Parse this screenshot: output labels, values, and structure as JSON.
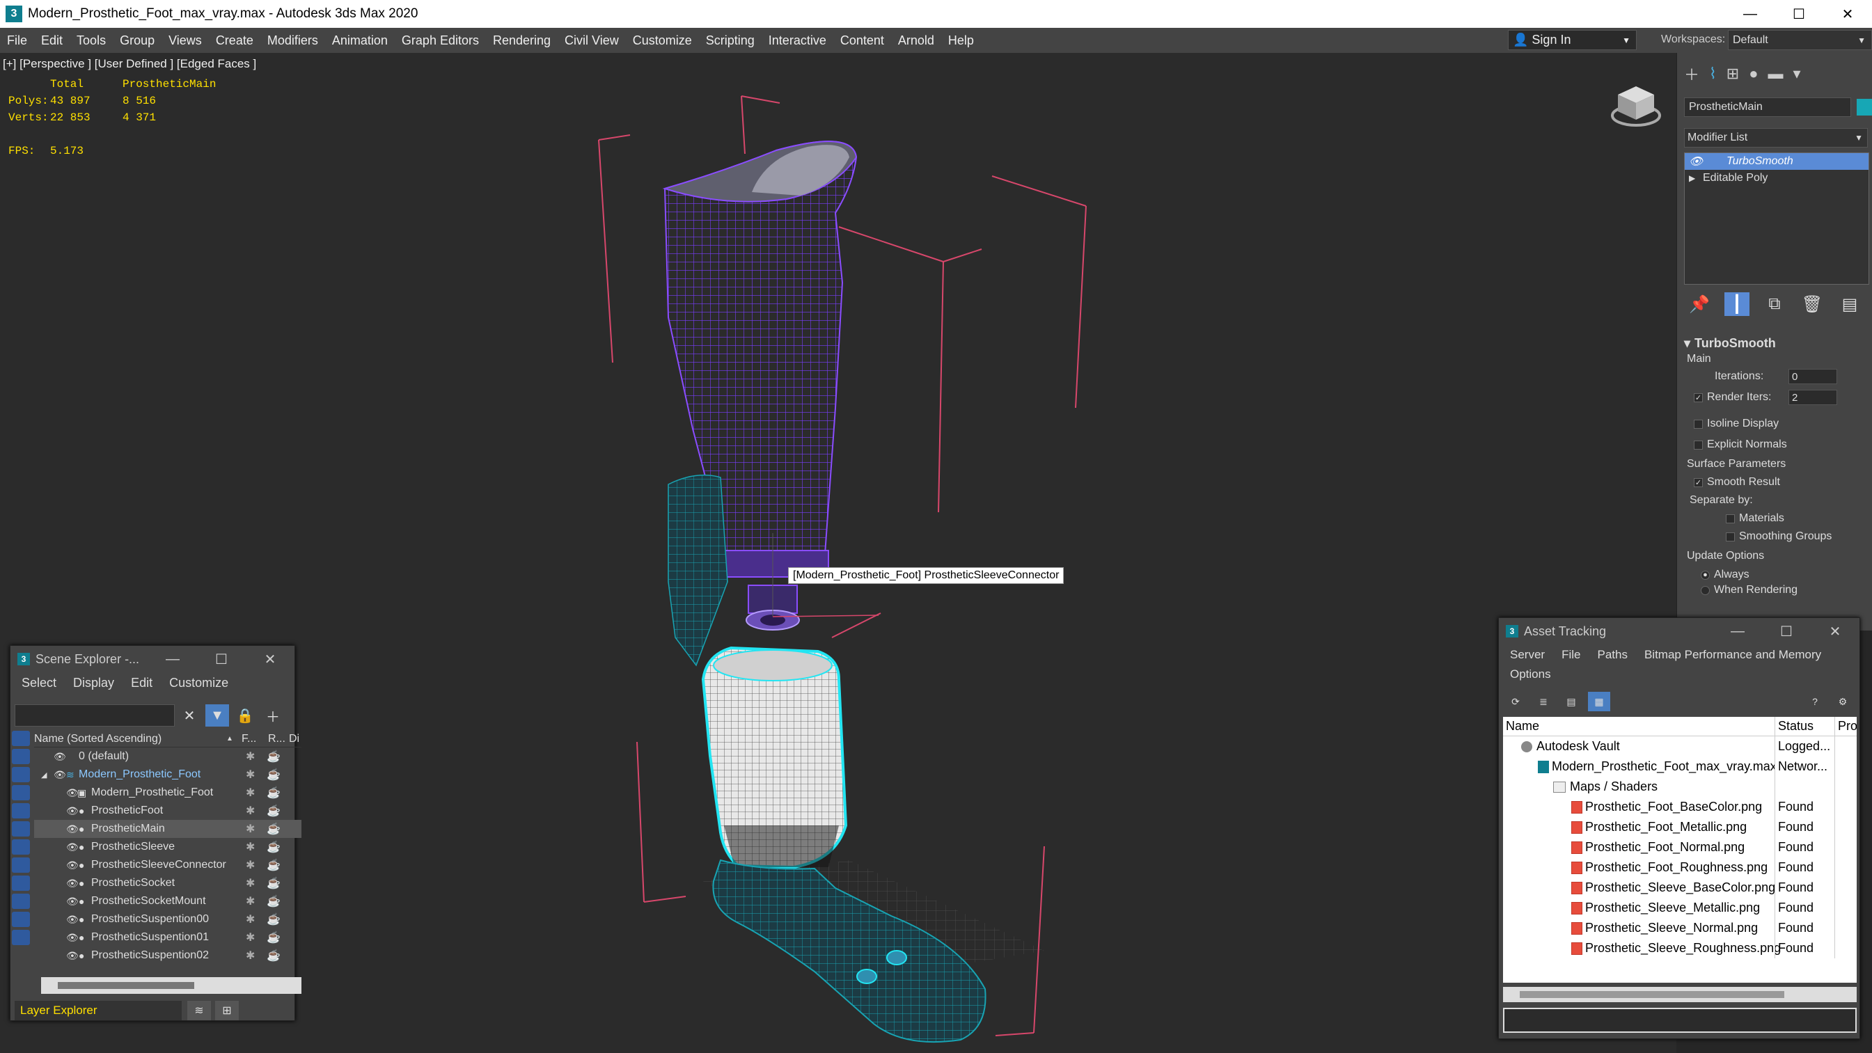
{
  "window": {
    "title": "Modern_Prosthetic_Foot_max_vray.max - Autodesk 3ds Max 2020",
    "app_icon": "3",
    "minimize": "—",
    "maximize": "☐",
    "close": "✕"
  },
  "menu": {
    "items": [
      "File",
      "Edit",
      "Tools",
      "Group",
      "Views",
      "Create",
      "Modifiers",
      "Animation",
      "Graph Editors",
      "Rendering",
      "Civil View",
      "Customize",
      "Scripting",
      "Interactive",
      "Content",
      "Arnold",
      "Help"
    ],
    "signin": "Sign In",
    "workspaces_label": "Workspaces:",
    "workspace": "Default"
  },
  "viewport": {
    "label": "[+] [Perspective ] [User Defined ] [Edged Faces ]",
    "stats": {
      "header_total": "Total",
      "header_obj": "ProstheticMain",
      "polys_label": "Polys:",
      "polys_total": "43 897",
      "polys_obj": "8 516",
      "verts_label": "Verts:",
      "verts_total": "22 853",
      "verts_obj": "4 371",
      "fps_label": "FPS:",
      "fps": "5.173"
    },
    "tooltip": "[Modern_Prosthetic_Foot] ProstheticSleeveConnector"
  },
  "command_panel": {
    "object_name": "ProstheticMain",
    "object_color": "#17a7b5",
    "modifier_list": "Modifier List",
    "stack": [
      "TurboSmooth",
      "Editable Poly"
    ],
    "rollout": {
      "title": "TurboSmooth",
      "main": "Main",
      "iterations_label": "Iterations:",
      "iterations": "0",
      "render_iters_label": "Render Iters:",
      "render_iters": "2",
      "isoline": "Isoline Display",
      "explicit_normals": "Explicit Normals",
      "surface_params": "Surface Parameters",
      "smooth_result": "Smooth Result",
      "separate_by": "Separate by:",
      "materials": "Materials",
      "smoothing_groups": "Smoothing Groups",
      "update_options": "Update Options",
      "always": "Always",
      "when_rendering": "When Rendering"
    }
  },
  "scene_explorer": {
    "title": "Scene Explorer -...",
    "menu": [
      "Select",
      "Display",
      "Edit",
      "Customize"
    ],
    "col_name": "Name (Sorted Ascending)",
    "col_f": "F...",
    "col_r": "R...",
    "col_d": "Di",
    "rows": [
      {
        "name": "0 (default)",
        "level": 0
      },
      {
        "name": "Modern_Prosthetic_Foot",
        "level": 0
      },
      {
        "name": "Modern_Prosthetic_Foot",
        "level": 1
      },
      {
        "name": "ProstheticFoot",
        "level": 1
      },
      {
        "name": "ProstheticMain",
        "level": 1
      },
      {
        "name": "ProstheticSleeve",
        "level": 1
      },
      {
        "name": "ProstheticSleeveConnector",
        "level": 1
      },
      {
        "name": "ProstheticSocket",
        "level": 1
      },
      {
        "name": "ProstheticSocketMount",
        "level": 1
      },
      {
        "name": "ProstheticSuspention00",
        "level": 1
      },
      {
        "name": "ProstheticSuspention01",
        "level": 1
      },
      {
        "name": "ProstheticSuspention02",
        "level": 1
      }
    ],
    "layer_explorer": "Layer Explorer"
  },
  "asset_tracking": {
    "title": "Asset Tracking",
    "menu": [
      "Server",
      "File",
      "Paths",
      "Bitmap Performance and Memory"
    ],
    "menu2": "Options",
    "col_name": "Name",
    "col_status": "Status",
    "col_pr": "Pro",
    "rows": [
      {
        "name": "Autodesk Vault",
        "status": "Logged...",
        "type": "vault",
        "level": 0
      },
      {
        "name": "Modern_Prosthetic_Foot_max_vray.max",
        "status": "Networ...",
        "type": "max",
        "level": 1
      },
      {
        "name": "Maps / Shaders",
        "status": "",
        "type": "folder",
        "level": 2
      },
      {
        "name": "Prosthetic_Foot_BaseColor.png",
        "status": "Found",
        "type": "file",
        "level": 3
      },
      {
        "name": "Prosthetic_Foot_Metallic.png",
        "status": "Found",
        "type": "file",
        "level": 3
      },
      {
        "name": "Prosthetic_Foot_Normal.png",
        "status": "Found",
        "type": "file",
        "level": 3
      },
      {
        "name": "Prosthetic_Foot_Roughness.png",
        "status": "Found",
        "type": "file",
        "level": 3
      },
      {
        "name": "Prosthetic_Sleeve_BaseColor.png",
        "status": "Found",
        "type": "file",
        "level": 3
      },
      {
        "name": "Prosthetic_Sleeve_Metallic.png",
        "status": "Found",
        "type": "file",
        "level": 3
      },
      {
        "name": "Prosthetic_Sleeve_Normal.png",
        "status": "Found",
        "type": "file",
        "level": 3
      },
      {
        "name": "Prosthetic_Sleeve_Roughness.png",
        "status": "Found",
        "type": "file",
        "level": 3
      }
    ]
  }
}
